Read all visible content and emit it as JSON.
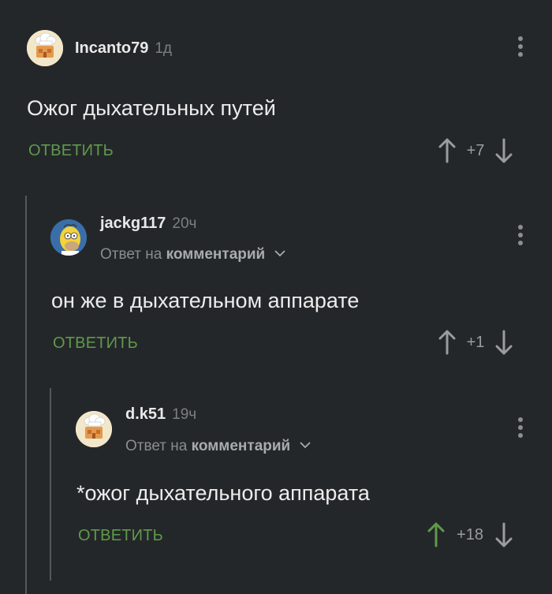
{
  "colors": {
    "background": "#24272a",
    "reply_green": "#5f9a4a",
    "upvoted_green": "#5f9a4a",
    "muted": "#8a8c8f",
    "thread_line": "#55585b"
  },
  "comments": [
    {
      "author": "Incanto79",
      "time": "1д",
      "avatar": "chef-hat-house-avatar",
      "reply_prefix": "",
      "reply_target": "",
      "text": "Ожог дыхательных путей",
      "reply_label": "ОТВЕТИТЬ",
      "score": "+7",
      "upvoted": false
    },
    {
      "author": "jackg117",
      "time": "20ч",
      "avatar": "homer-avatar",
      "reply_prefix": "Ответ на",
      "reply_target": "комментарий",
      "text": "он же в дыхательном аппарате",
      "reply_label": "ОТВЕТИТЬ",
      "score": "+1",
      "upvoted": false
    },
    {
      "author": "d.k51",
      "time": "19ч",
      "avatar": "chef-hat-house-avatar",
      "reply_prefix": "Ответ на",
      "reply_target": "комментарий",
      "text": "*ожог дыхательного аппарата",
      "reply_label": "ОТВЕТИТЬ",
      "score": "+18",
      "upvoted": true
    }
  ]
}
